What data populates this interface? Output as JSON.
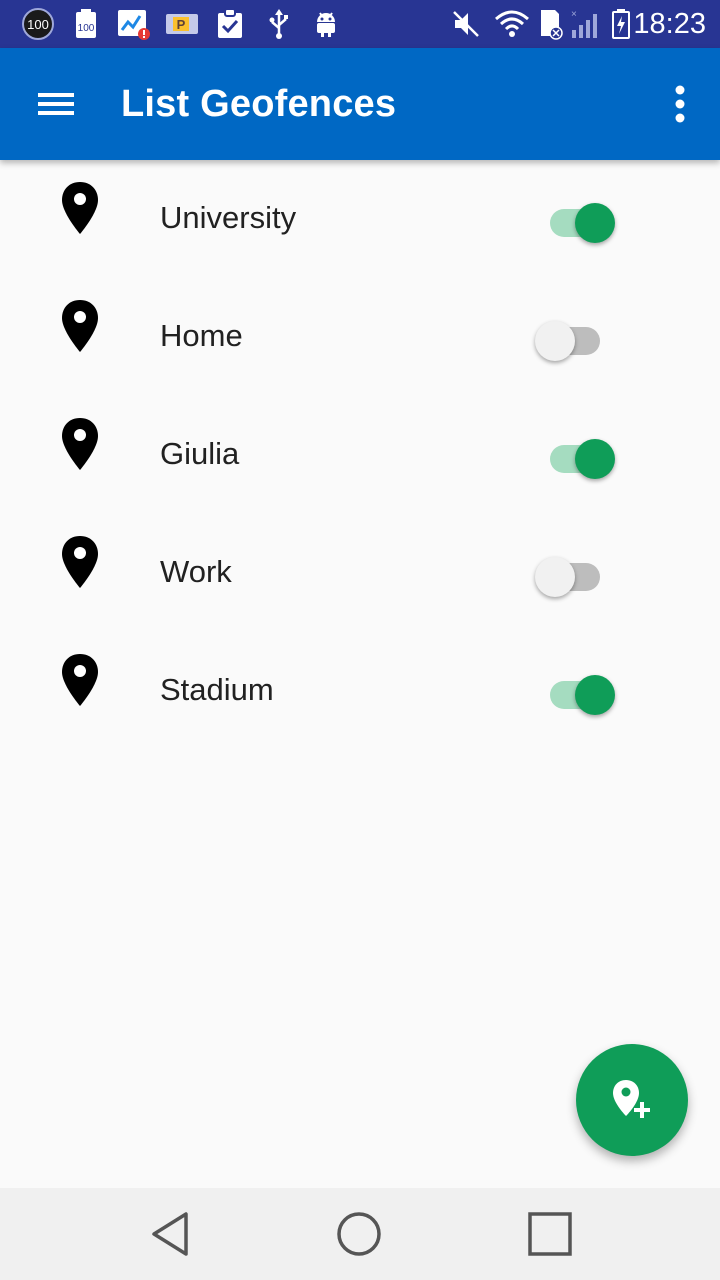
{
  "status_bar": {
    "time": "18:23",
    "icons": [
      "badge-100-icon",
      "battery-100-icon",
      "gallery-alert-icon",
      "parking-icon",
      "clipboard-check-icon",
      "usb-icon",
      "android-icon",
      "mute-icon",
      "wifi-icon",
      "sd-card-icon",
      "signal-icon",
      "battery-charging-icon"
    ],
    "left_badge_text": "100",
    "second_badge_text": "100",
    "parking_text": "P"
  },
  "app_bar": {
    "title": "List Geofences",
    "menu_icon": "hamburger-menu-icon",
    "overflow_icon": "more-vertical-icon",
    "background": "#0068c4"
  },
  "geofences": [
    {
      "name": "University",
      "enabled": true
    },
    {
      "name": "Home",
      "enabled": false
    },
    {
      "name": "Giulia",
      "enabled": true
    },
    {
      "name": "Work",
      "enabled": false
    },
    {
      "name": "Stadium",
      "enabled": true
    }
  ],
  "fab": {
    "icon": "add-location-icon",
    "color": "#0f9d58"
  },
  "nav_bar": {
    "icons": [
      "back-icon",
      "home-icon",
      "recents-icon"
    ]
  },
  "colors": {
    "status_bar": "#283593",
    "switch_on_thumb": "#0f9d58",
    "switch_on_track": "#a5dcc0",
    "switch_off_thumb": "#f1f1f1",
    "switch_off_track": "#bdbdbd"
  }
}
